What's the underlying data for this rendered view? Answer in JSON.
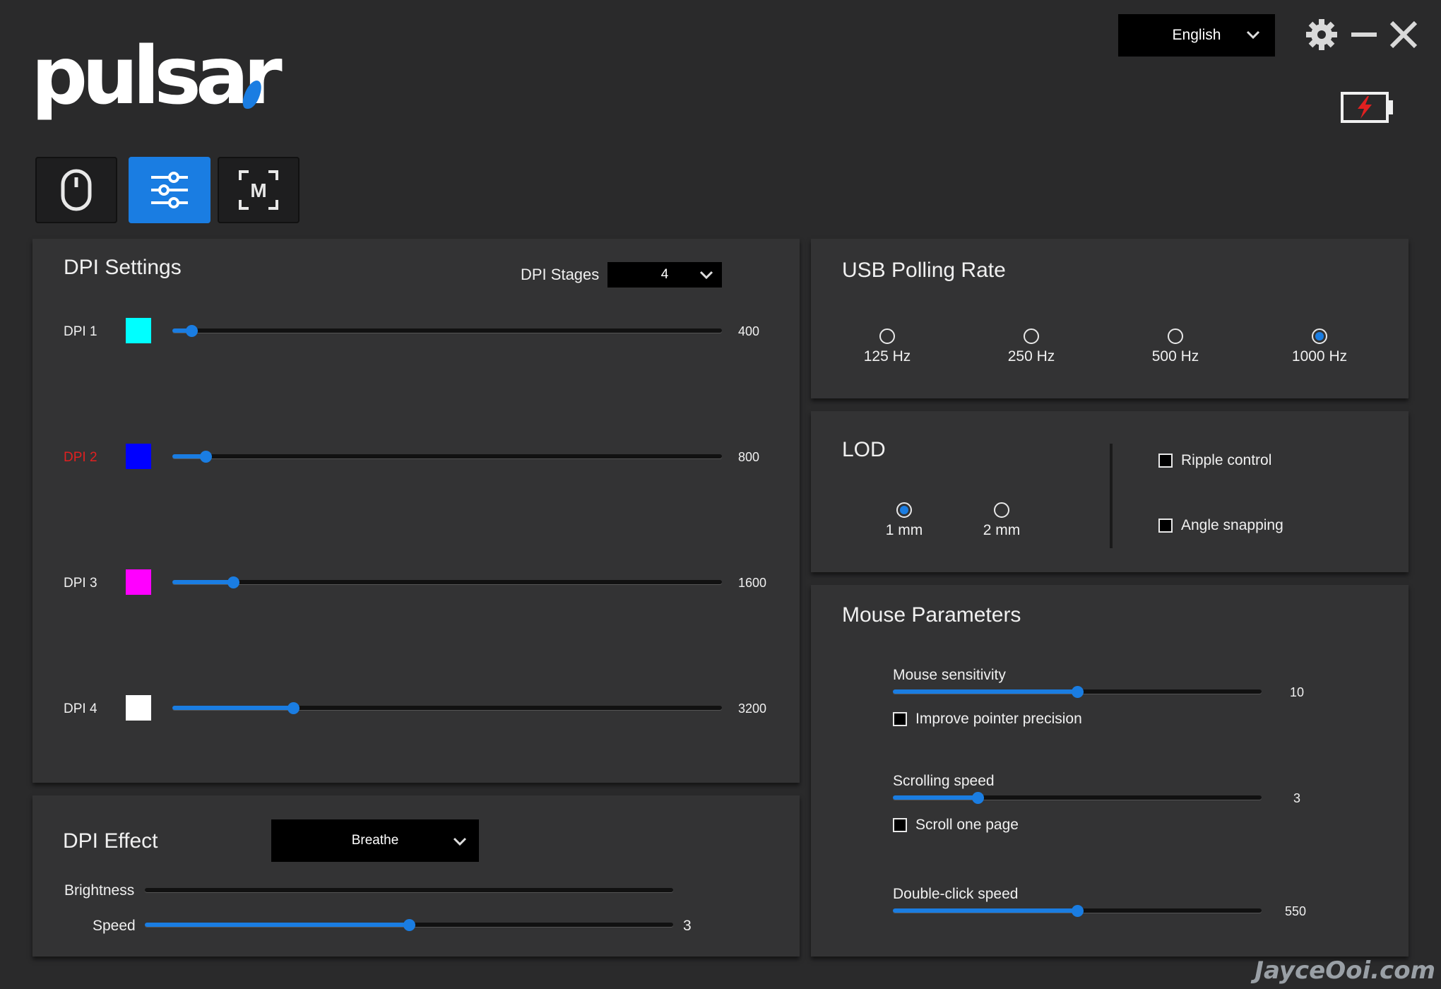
{
  "app": {
    "logo_text": "pulsar",
    "language": "English",
    "accent_color": "#1a7de2"
  },
  "window_controls": [
    "gear-icon",
    "minimize-icon",
    "close-icon"
  ],
  "tabs": [
    {
      "name": "mouse-icon",
      "active": false
    },
    {
      "name": "sliders-icon",
      "active": true
    },
    {
      "name": "macro-icon",
      "active": false
    }
  ],
  "dpi_settings": {
    "title": "DPI Settings",
    "stages_label": "DPI Stages",
    "stages_value": "4",
    "stages": [
      {
        "label": "DPI 1",
        "color": "#00ffff",
        "value": "400",
        "fraction": 0.035,
        "highlight": false
      },
      {
        "label": "DPI 2",
        "color": "#0000ff",
        "value": "800",
        "fraction": 0.06,
        "highlight": true
      },
      {
        "label": "DPI 3",
        "color": "#ff00ff",
        "value": "1600",
        "fraction": 0.11,
        "highlight": false
      },
      {
        "label": "DPI 4",
        "color": "#ffffff",
        "value": "3200",
        "fraction": 0.22,
        "highlight": false
      }
    ]
  },
  "dpi_effect": {
    "title": "DPI Effect",
    "mode": "Breathe",
    "brightness_label": "Brightness",
    "brightness_fraction": 0,
    "speed_label": "Speed",
    "speed_value": "3",
    "speed_fraction": 0.5
  },
  "usb_polling": {
    "title": "USB Polling Rate",
    "options": [
      "125 Hz",
      "250 Hz",
      "500 Hz",
      "1000 Hz"
    ],
    "selected": "1000 Hz"
  },
  "lod": {
    "title": "LOD",
    "options": [
      "1 mm",
      "2 mm"
    ],
    "selected": "1 mm",
    "ripple_label": "Ripple control",
    "ripple_checked": false,
    "angle_label": "Angle snapping",
    "angle_checked": false
  },
  "mouse_params": {
    "title": "Mouse Parameters",
    "sensitivity_label": "Mouse sensitivity",
    "sensitivity_value": "10",
    "sensitivity_fraction": 0.5,
    "precision_label": "Improve pointer precision",
    "precision_checked": false,
    "scroll_label": "Scrolling speed",
    "scroll_value": "3",
    "scroll_fraction": 0.23,
    "scroll_page_label": "Scroll one page",
    "scroll_page_checked": false,
    "dblclick_label": "Double-click speed",
    "dblclick_value": "550",
    "dblclick_fraction": 0.5
  },
  "watermark": "JayceOoi.com"
}
